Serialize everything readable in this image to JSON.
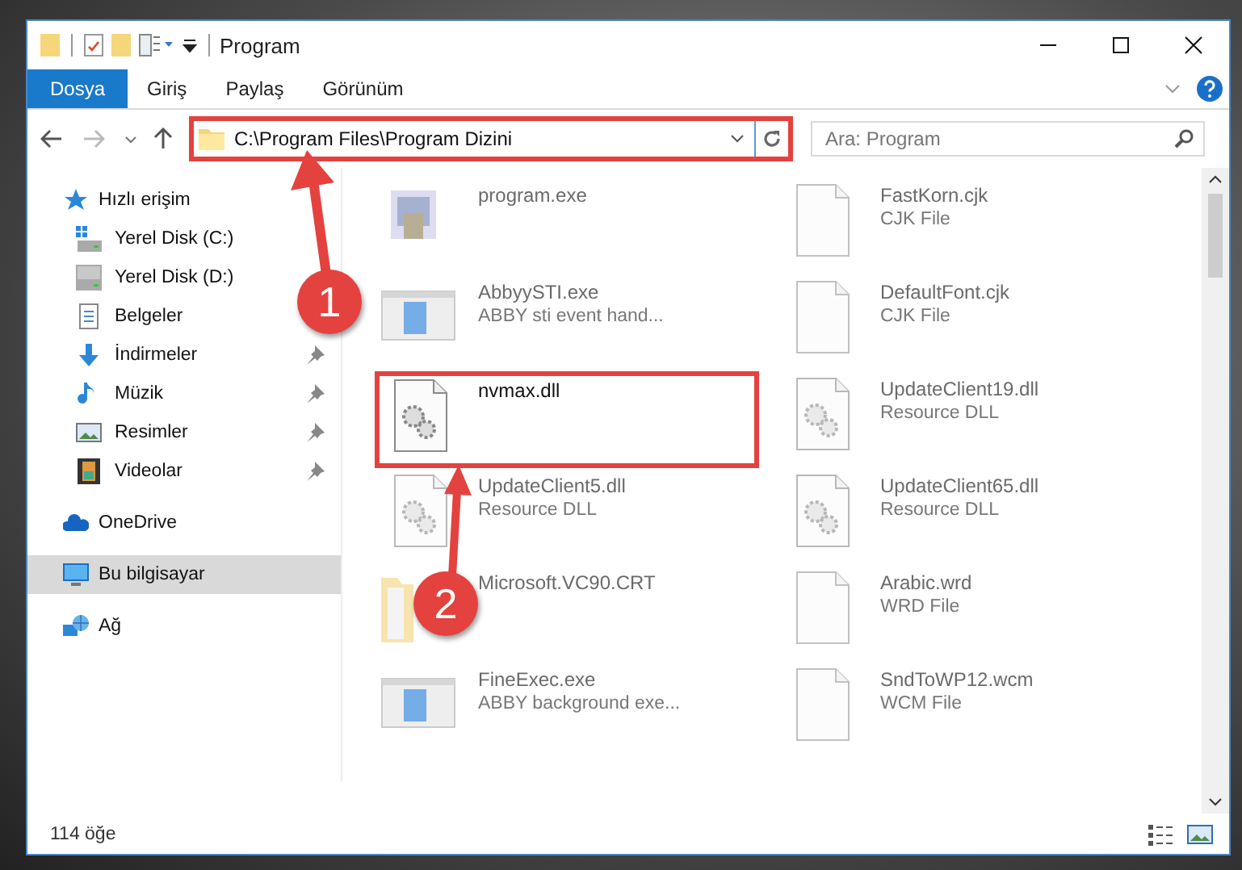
{
  "window": {
    "title": "Program"
  },
  "ribbon_tabs": [
    {
      "label": "Dosya",
      "selected": true
    },
    {
      "label": "Giriş",
      "selected": false
    },
    {
      "label": "Paylaş",
      "selected": false
    },
    {
      "label": "Görünüm",
      "selected": false
    }
  ],
  "address": {
    "value": "C:\\Program Files\\Program Dizini",
    "highlighted": true
  },
  "search": {
    "placeholder": "Ara: Program"
  },
  "sidebar": {
    "items": [
      {
        "label": "Hızlı erişim",
        "kind": "quick",
        "selected": false,
        "children": [
          {
            "label": "Yerel Disk (C:)",
            "kind": "drive-c",
            "selected": false,
            "pinned": false
          },
          {
            "label": "Yerel Disk (D:)",
            "kind": "drive",
            "selected": false,
            "pinned": false
          },
          {
            "label": "Belgeler",
            "kind": "docs",
            "selected": false,
            "pinned": false
          },
          {
            "label": "İndirmeler",
            "kind": "download",
            "selected": false,
            "pinned": true
          },
          {
            "label": "Müzik",
            "kind": "music",
            "selected": false,
            "pinned": true
          },
          {
            "label": "Resimler",
            "kind": "pictures",
            "selected": false,
            "pinned": true
          },
          {
            "label": "Videolar",
            "kind": "video",
            "selected": false,
            "pinned": true
          }
        ]
      },
      {
        "label": "OneDrive",
        "kind": "cloud",
        "selected": false
      },
      {
        "label": "Bu bilgisayar",
        "kind": "pc",
        "selected": true
      },
      {
        "label": "Ağ",
        "kind": "network",
        "selected": false
      }
    ]
  },
  "files": [
    {
      "name": "program.exe",
      "kind": "app",
      "blurred": true,
      "highlighted": false
    },
    {
      "name": "FastKorn.cjk",
      "type": "CJK File",
      "kind": "doc",
      "blurred": true,
      "highlighted": false
    },
    {
      "name": "AbbyySTI.exe",
      "type": "ABBY sti event hand...",
      "kind": "window",
      "blurred": true,
      "highlighted": false
    },
    {
      "name": "DefaultFont.cjk",
      "type": "CJK File",
      "kind": "doc",
      "blurred": true,
      "highlighted": false
    },
    {
      "name": "nvmax.dll",
      "kind": "dll",
      "blurred": false,
      "highlighted": true
    },
    {
      "name": "UpdateClient19.dll",
      "type": "Resource DLL",
      "kind": "dll",
      "blurred": true,
      "highlighted": false
    },
    {
      "name": "UpdateClient5.dll",
      "type": "Resource DLL",
      "kind": "dll",
      "blurred": true,
      "highlighted": false
    },
    {
      "name": "UpdateClient65.dll",
      "type": "Resource DLL",
      "kind": "dll",
      "blurred": true,
      "highlighted": false
    },
    {
      "name": "Microsoft.VC90.CRT",
      "kind": "folder",
      "blurred": true,
      "highlighted": false
    },
    {
      "name": "Arabic.wrd",
      "type": "WRD File",
      "kind": "doc",
      "blurred": true,
      "highlighted": false
    },
    {
      "name": "FineExec.exe",
      "type": "ABBY background exe...",
      "kind": "window",
      "blurred": true,
      "highlighted": false
    },
    {
      "name": "SndToWP12.wcm",
      "type": "WCM File",
      "kind": "doc",
      "blurred": true,
      "highlighted": false
    }
  ],
  "status_bar": {
    "count": "114 öğe"
  },
  "callouts": [
    {
      "number": "1"
    },
    {
      "number": "2"
    }
  ]
}
